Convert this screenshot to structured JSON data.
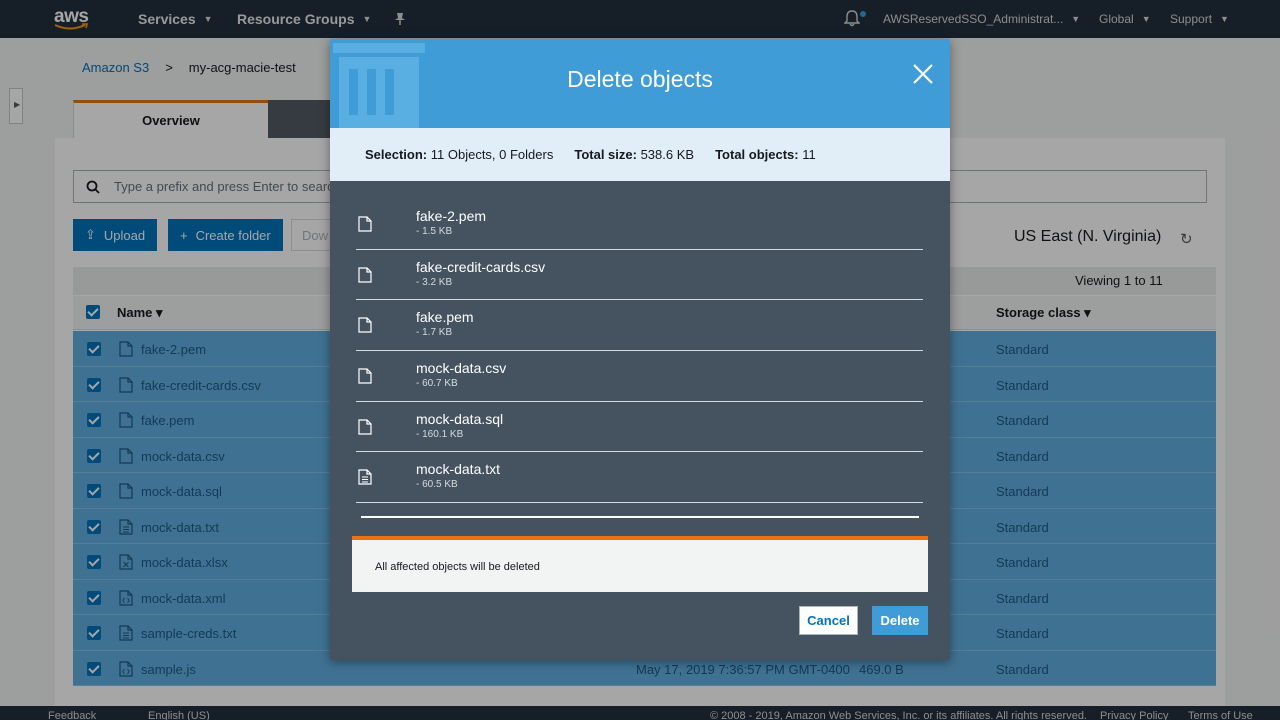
{
  "nav": {
    "logo_text": "aws",
    "services": "Services",
    "resource_groups": "Resource Groups",
    "account": "AWSReservedSSO_Administrat...",
    "region": "Global",
    "support": "Support"
  },
  "breadcrumb": {
    "root": "Amazon S3",
    "separator": ">",
    "bucket": "my-acg-macie-test"
  },
  "tabs": {
    "overview": "Overview"
  },
  "search": {
    "placeholder": "Type a prefix and press Enter to search"
  },
  "toolbar": {
    "upload": "Upload",
    "create_folder": "Create folder",
    "download_partial": "Dow"
  },
  "region_label": "US East (N. Virginia)",
  "viewing": "Viewing 1 to 11",
  "table": {
    "col_name": "Name",
    "col_storage": "Storage class",
    "rows": [
      {
        "name": "fake-2.pem",
        "date": "",
        "size": "",
        "storage": "Standard",
        "icon": "file-icon"
      },
      {
        "name": "fake-credit-cards.csv",
        "date": "",
        "size": "",
        "storage": "Standard",
        "icon": "file-icon"
      },
      {
        "name": "fake.pem",
        "date": "",
        "size": "",
        "storage": "Standard",
        "icon": "file-icon"
      },
      {
        "name": "mock-data.csv",
        "date": "",
        "size": "",
        "storage": "Standard",
        "icon": "file-icon"
      },
      {
        "name": "mock-data.sql",
        "date": "",
        "size": "",
        "storage": "Standard",
        "icon": "file-icon"
      },
      {
        "name": "mock-data.txt",
        "date": "",
        "size": "",
        "storage": "Standard",
        "icon": "text-file-icon"
      },
      {
        "name": "mock-data.xlsx",
        "date": "",
        "size": "",
        "storage": "Standard",
        "icon": "spreadsheet-file-icon"
      },
      {
        "name": "mock-data.xml",
        "date": "",
        "size": "",
        "storage": "Standard",
        "icon": "code-file-icon"
      },
      {
        "name": "sample-creds.txt",
        "date": "",
        "size": "",
        "storage": "Standard",
        "icon": "text-file-icon"
      },
      {
        "name": "sample.js",
        "date": "May 17, 2019 7:36:57 PM GMT-0400",
        "size": "469.0 B",
        "storage": "Standard",
        "icon": "code-file-icon"
      }
    ]
  },
  "footer": {
    "feedback": "Feedback",
    "language": "English (US)",
    "copyright": "© 2008 - 2019, Amazon Web Services, Inc. or its affiliates. All rights reserved.",
    "privacy": "Privacy Policy",
    "terms": "Terms of Use"
  },
  "modal": {
    "title": "Delete objects",
    "selection_label": "Selection:",
    "selection_value": "11 Objects, 0 Folders",
    "total_size_label": "Total size:",
    "total_size_value": "538.6 KB",
    "total_objects_label": "Total objects:",
    "total_objects_value": "11",
    "items": [
      {
        "name": "fake-2.pem",
        "size": "- 1.5 KB",
        "icon": "file-icon"
      },
      {
        "name": "fake-credit-cards.csv",
        "size": "- 3.2 KB",
        "icon": "file-icon"
      },
      {
        "name": "fake.pem",
        "size": "- 1.7 KB",
        "icon": "file-icon"
      },
      {
        "name": "mock-data.csv",
        "size": "- 60.7 KB",
        "icon": "file-icon"
      },
      {
        "name": "mock-data.sql",
        "size": "- 160.1 KB",
        "icon": "file-icon"
      },
      {
        "name": "mock-data.txt",
        "size": "- 60.5 KB",
        "icon": "text-file-icon"
      }
    ],
    "notice": "All affected objects will be deleted",
    "cancel": "Cancel",
    "delete": "Delete"
  },
  "colors": {
    "nav_bg": "#232f3e",
    "accent_blue": "#0073bb",
    "modal_header": "#3f9cd6",
    "modal_body": "#455361",
    "notice_border": "#ec7211",
    "row_selected": "#62b0e0"
  }
}
